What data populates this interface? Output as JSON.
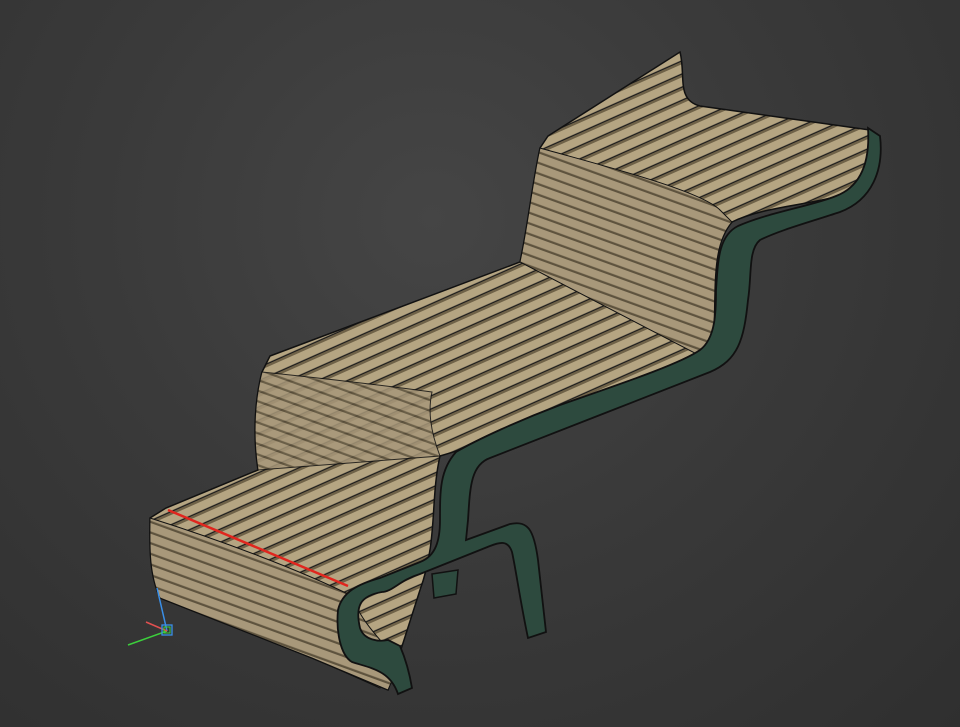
{
  "viewport": {
    "background": "#3a3a3a",
    "model": {
      "name": "Wave bench",
      "slat_color": "#b5a582",
      "slat_dark": "#8e7f62",
      "frame_color": "#2d4a3e",
      "outline_color": "#111111",
      "selected_edge_color": "#e0261e",
      "slat_count": 80
    },
    "axis_gizmo": {
      "x_color": "#e05050",
      "y_color": "#3ccf3c",
      "z_color": "#3a8fe8",
      "icon": "axis-triad-icon"
    }
  }
}
